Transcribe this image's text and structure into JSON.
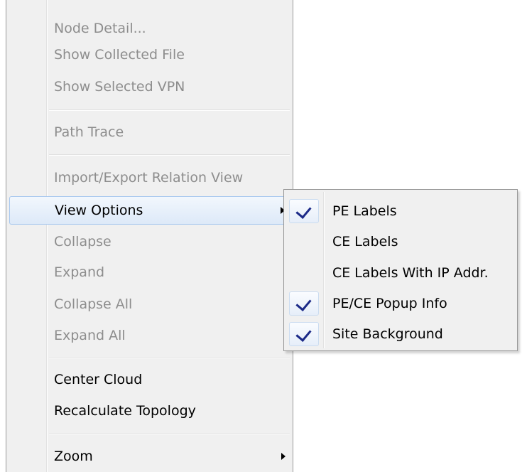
{
  "context_menu": {
    "items": [
      {
        "label": "Node Detail...",
        "enabled": false
      },
      {
        "label": "Show Collected File",
        "enabled": false
      },
      {
        "label": "Show Selected VPN",
        "enabled": false
      },
      {
        "label": "Path Trace",
        "enabled": false
      },
      {
        "label": "Import/Export Relation View",
        "enabled": false
      },
      {
        "label": "View Options",
        "enabled": true,
        "highlighted": true,
        "has_submenu": true
      },
      {
        "label": "Collapse",
        "enabled": false
      },
      {
        "label": "Expand",
        "enabled": false
      },
      {
        "label": "Collapse All",
        "enabled": false
      },
      {
        "label": "Expand All",
        "enabled": false
      },
      {
        "label": "Center Cloud",
        "enabled": true
      },
      {
        "label": "Recalculate Topology",
        "enabled": true
      },
      {
        "label": "Zoom",
        "enabled": true,
        "has_submenu": true
      }
    ]
  },
  "view_options_submenu": {
    "items": [
      {
        "label": "PE Labels",
        "checked": true
      },
      {
        "label": "CE Labels",
        "checked": false
      },
      {
        "label": "CE Labels With IP Addr.",
        "checked": false
      },
      {
        "label": "PE/CE Popup Info",
        "checked": true
      },
      {
        "label": "Site Background",
        "checked": true
      }
    ]
  },
  "colors": {
    "menu_background": "#f0f0f0",
    "disabled_text": "#8d8d8d",
    "highlight_border": "#a8c8ef",
    "checkmark": "#1c2a88"
  }
}
